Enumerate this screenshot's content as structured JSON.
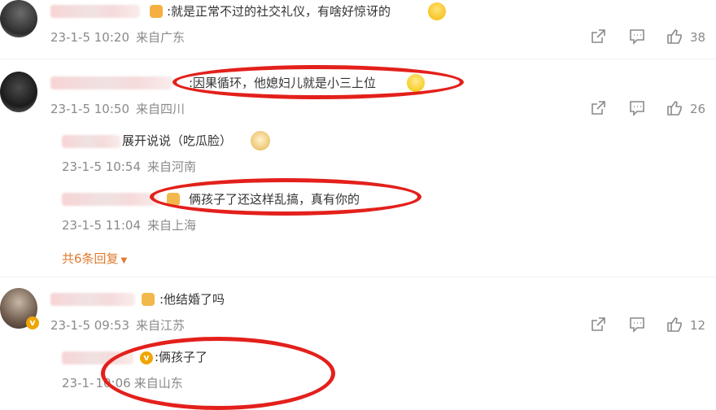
{
  "comments": [
    {
      "text": ":就是正常不过的社交礼仪，有啥好惊讶的",
      "date": "23-1-5 10:20",
      "location": "来自广东",
      "likes": "38"
    },
    {
      "text": ":因果循环，他媳妇儿就是小三上位",
      "date": "23-1-5 10:50",
      "location": "来自四川",
      "likes": "26",
      "replies": [
        {
          "text": "展开说说（吃瓜脸）",
          "date": "23-1-5 10:54",
          "location": "来自河南"
        },
        {
          "text": "俩孩子了还这样乱搞，真有你的",
          "date": "23-1-5 11:04",
          "location": "来自上海"
        }
      ],
      "more_replies": "共6条回复"
    },
    {
      "text": ":他结婚了吗",
      "date": "23-1-5 09:53",
      "location": "来自江苏",
      "likes": "12",
      "replies": [
        {
          "text": ":俩孩子了",
          "date": "23-1-",
          "date_tail": "10:06",
          "location": "来自山东"
        }
      ]
    }
  ],
  "colors": {
    "highlight": "#e3201b",
    "meta": "#8a8a8a",
    "link": "#e07a2f"
  },
  "icons": [
    "share-icon",
    "comment-icon",
    "like-icon"
  ]
}
